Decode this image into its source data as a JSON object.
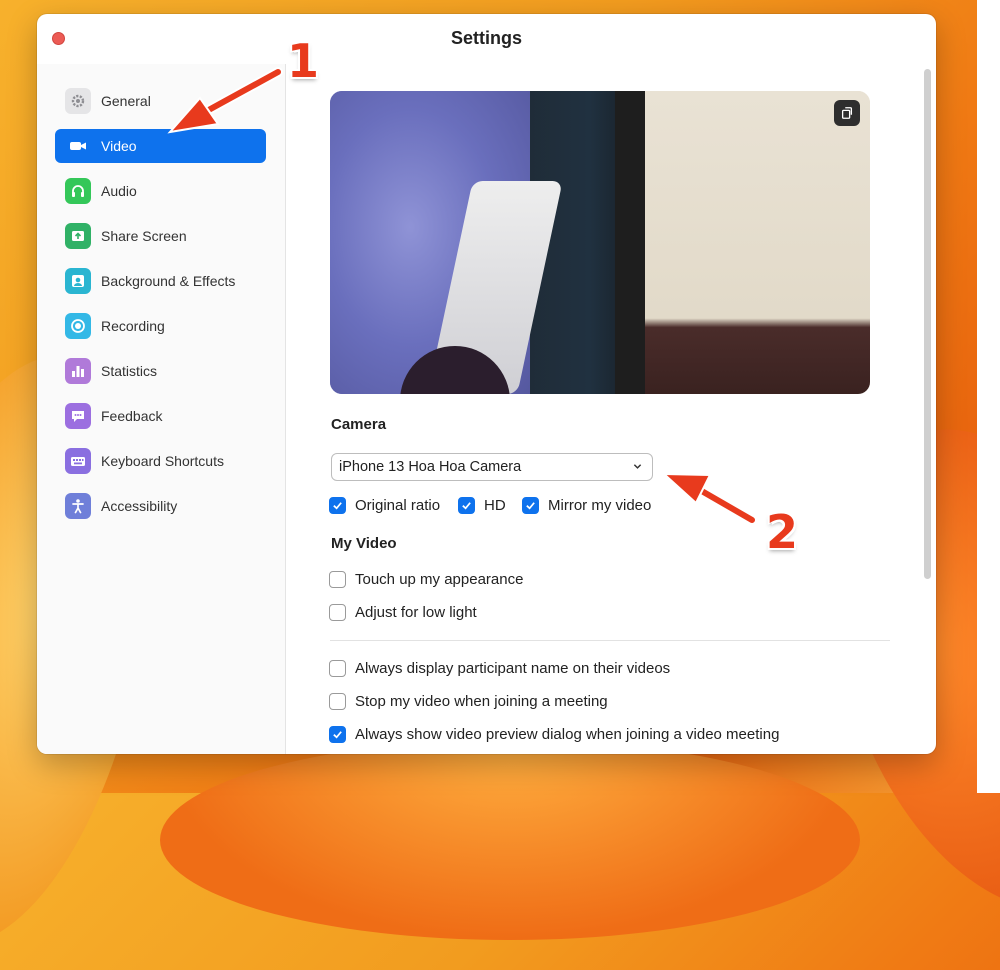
{
  "window": {
    "title": "Settings"
  },
  "sidebar": {
    "items": [
      {
        "label": "General",
        "icon": "gear-icon",
        "color": "#8e8e93",
        "active": false
      },
      {
        "label": "Video",
        "icon": "video-camera-icon",
        "color": "#0e72ed",
        "active": true
      },
      {
        "label": "Audio",
        "icon": "headphones-icon",
        "color": "#34c759",
        "active": false
      },
      {
        "label": "Share Screen",
        "icon": "share-screen-icon",
        "color": "#30b166",
        "active": false
      },
      {
        "label": "Background & Effects",
        "icon": "background-icon",
        "color": "#2ab5d1",
        "active": false
      },
      {
        "label": "Recording",
        "icon": "recording-icon",
        "color": "#33b8e6",
        "active": false
      },
      {
        "label": "Statistics",
        "icon": "statistics-icon",
        "color": "#b07ad9",
        "active": false
      },
      {
        "label": "Feedback",
        "icon": "feedback-icon",
        "color": "#9c6fe0",
        "active": false
      },
      {
        "label": "Keyboard Shortcuts",
        "icon": "keyboard-icon",
        "color": "#8a6fe0",
        "active": false
      },
      {
        "label": "Accessibility",
        "icon": "accessibility-icon",
        "color": "#6f7fd9",
        "active": false
      }
    ]
  },
  "main": {
    "camera_label": "Camera",
    "camera_select": {
      "value": "iPhone 13 Hoa Hoa Camera"
    },
    "camera_options": [
      {
        "label": "Original ratio",
        "checked": true
      },
      {
        "label": "HD",
        "checked": true
      },
      {
        "label": "Mirror my video",
        "checked": true
      }
    ],
    "my_video_label": "My Video",
    "my_video_options": [
      {
        "label": "Touch up my appearance",
        "checked": false
      },
      {
        "label": "Adjust for low light",
        "checked": false
      }
    ],
    "meeting_options": [
      {
        "label": "Always display participant name on their videos",
        "checked": false
      },
      {
        "label": "Stop my video when joining a meeting",
        "checked": false
      },
      {
        "label": "Always show video preview dialog when joining a video meeting",
        "checked": true
      }
    ]
  },
  "annotations": {
    "step1": "1",
    "step2": "2"
  },
  "colors": {
    "accent": "#0e72ed",
    "annotation": "#e83a1d"
  }
}
